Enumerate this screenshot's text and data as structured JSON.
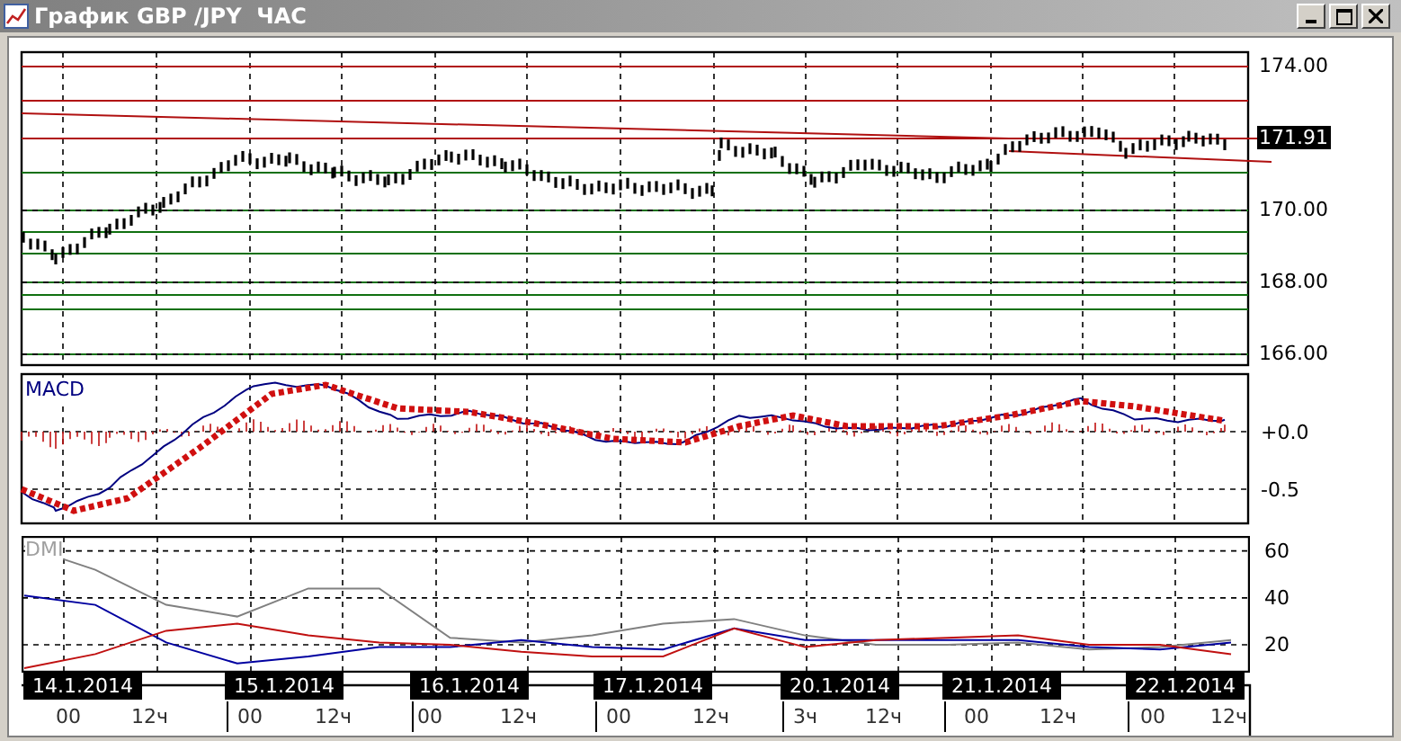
{
  "window": {
    "title": "График GBP /JPY  ЧАС"
  },
  "price_panel": {
    "y_labels": [
      {
        "text": "174.00",
        "kind": "tick"
      },
      {
        "text": "171.91",
        "kind": "current"
      },
      {
        "text": "170.00",
        "kind": "tick"
      },
      {
        "text": "168.00",
        "kind": "tick"
      },
      {
        "text": "166.00",
        "kind": "tick"
      }
    ]
  },
  "macd_panel": {
    "title": "MACD",
    "y_labels": [
      "+0.0",
      "-0.5"
    ]
  },
  "dmi_panel": {
    "title": "DMI",
    "chart_data": {
      "type": "line",
      "grid": true,
      "ylim": [
        8.5,
        66
      ],
      "yticks": [
        {
          "value": 60,
          "label": "60"
        },
        {
          "value": 40,
          "label": "40"
        },
        {
          "value": 20,
          "label": "20"
        }
      ],
      "series": [
        {
          "color": "#808080",
          "values": [
            62,
            52,
            37,
            32,
            44,
            44,
            23,
            21,
            24,
            29,
            31,
            24,
            20,
            20,
            21,
            18,
            19,
            22
          ]
        },
        {
          "color": "#0000a0",
          "values": [
            41,
            37,
            21,
            12,
            15,
            19,
            19,
            22,
            19,
            18,
            27,
            22,
            22,
            22,
            22,
            19,
            18,
            21
          ]
        },
        {
          "color": "#c01010",
          "values": [
            10,
            16,
            26,
            29,
            24,
            21,
            20,
            17,
            15,
            15,
            27,
            19,
            22,
            23,
            24,
            20,
            20,
            16
          ]
        }
      ]
    }
  },
  "time_axis": [
    {
      "date": "14.1.2014",
      "hours": [
        "00",
        "12ч"
      ]
    },
    {
      "date": "15.1.2014",
      "hours": [
        "00",
        "12ч"
      ]
    },
    {
      "date": "16.1.2014",
      "hours": [
        "00",
        "12ч"
      ]
    },
    {
      "date": "17.1.2014",
      "hours": [
        "00",
        "12ч"
      ]
    },
    {
      "date": "20.1.2014",
      "hours": [
        "3ч",
        "12ч"
      ]
    },
    {
      "date": "21.1.2014",
      "hours": [
        "00",
        "12ч"
      ]
    },
    {
      "date": "22.1.2014",
      "hours": [
        "00",
        "12ч"
      ]
    }
  ]
}
